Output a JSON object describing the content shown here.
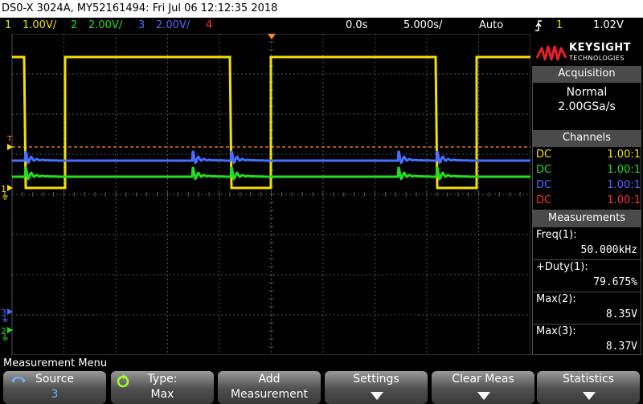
{
  "title_bar": {
    "text": "DS0-X 3024A, MY52161494: Fri Jul 06 12:12:35 2018"
  },
  "status_bar": {
    "ch1_num": "1",
    "ch1_scale": "1.00V/",
    "ch2_num": "2",
    "ch2_scale": "2.00V/",
    "ch3_num": "3",
    "ch3_scale": "2.00V/",
    "ch4_num": "4",
    "delay": "0.0s",
    "timebase": "5.000s/",
    "trigger_mode": "Auto",
    "trigger_icon": "trigger-edge-rising",
    "trigger_source": "1",
    "trigger_level": "1.02V"
  },
  "logo": {
    "line1": "KEYSIGHT",
    "line2": "TECHNOLOGIES"
  },
  "acquisition": {
    "header": "Acquisition",
    "mode": "Normal",
    "rate": "2.00GSa/s"
  },
  "channels": {
    "header": "Channels",
    "rows": [
      {
        "coupling": "DC",
        "probe": "1.00:1",
        "color": "#f2e000"
      },
      {
        "coupling": "DC",
        "probe": "1.00:1",
        "color": "#22dd22"
      },
      {
        "coupling": "DC",
        "probe": "1.00:1",
        "color": "#4a6cff"
      },
      {
        "coupling": "DC",
        "probe": "1.00:1",
        "color": "#ff3030"
      }
    ]
  },
  "measurements": {
    "header": "Measurements",
    "items": [
      {
        "label": "Freq(1):",
        "value": "50.000kHz"
      },
      {
        "label": "+Duty(1):",
        "value": "79.675%"
      },
      {
        "label": "Max(2):",
        "value": "8.35V"
      },
      {
        "label": "Max(3):",
        "value": "8.37V"
      }
    ]
  },
  "markers": {
    "trigger_level": "T",
    "ch1": "1",
    "ch2": "2",
    "ch3": "3"
  },
  "menu": {
    "title": "Measurement Menu",
    "softkeys": [
      {
        "line1": "Source",
        "line2": "3"
      },
      {
        "line1": "Type:",
        "line2": "Max"
      },
      {
        "line1": "Add",
        "line2": "Measurement"
      },
      {
        "line1": "Settings",
        "line2": ""
      },
      {
        "line1": "Clear Meas",
        "line2": ""
      },
      {
        "line1": "Statistics",
        "line2": ""
      }
    ]
  },
  "colors": {
    "ch1": "#f2e000",
    "ch2": "#22dd22",
    "ch3": "#4a6cff",
    "ch4": "#ff3030",
    "trigger_line": "#ff8c1a",
    "grid": "#555555",
    "panel_header": "#4a4a4a"
  }
}
